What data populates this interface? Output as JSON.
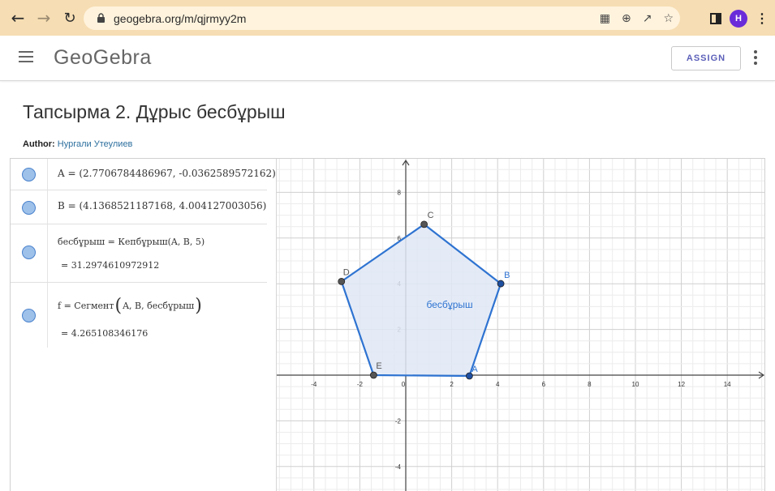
{
  "browser": {
    "url": "geogebra.org/m/qjrmyy2m",
    "avatar_letter": "H"
  },
  "app": {
    "logo": "GeoGebra",
    "assign_label": "ASSIGN"
  },
  "page": {
    "title": "Тапсырма 2. Дұрыс бесбұрыш",
    "author_label": "Author:",
    "author_name": "Нургали Утеулиев"
  },
  "algebra": {
    "row_a": "A = (2.7706784486967, -0.0362589572162)",
    "row_b": "B = (4.1368521187168, 4.004127003056)",
    "row_poly_def": "бесбұрыш = Кепбұрыш(A, B, 5)",
    "row_poly_value": "= 31.2974610972912",
    "row_f_name": "f = Сегмент",
    "row_f_args": "A, B, бесбұрыш",
    "row_f_value": "= 4.265108346176"
  },
  "graph": {
    "polygon_label": "бесбұрыш",
    "points": [
      {
        "name": "A",
        "x": 2.77,
        "y": -0.036,
        "free": true
      },
      {
        "name": "B",
        "x": 4.137,
        "y": 4.004,
        "free": true
      },
      {
        "name": "C",
        "x": 0.8,
        "y": 6.6,
        "free": false
      },
      {
        "name": "D",
        "x": -2.8,
        "y": 4.1,
        "free": false
      },
      {
        "name": "E",
        "x": -1.4,
        "y": 0.0,
        "free": false
      }
    ],
    "x_ticks": [
      "-4",
      "-2",
      "0",
      "2",
      "4",
      "6",
      "8",
      "10",
      "12",
      "14"
    ],
    "y_ticks": [
      "8",
      "6",
      "4",
      "2",
      "-2",
      "-4"
    ],
    "colors": {
      "polygon_stroke": "#2e73d1",
      "polygon_fill": "#dfe8f6",
      "free_point": "#1e4fa0",
      "dependent_point": "#555555",
      "label_blue": "#2e73d1"
    }
  }
}
